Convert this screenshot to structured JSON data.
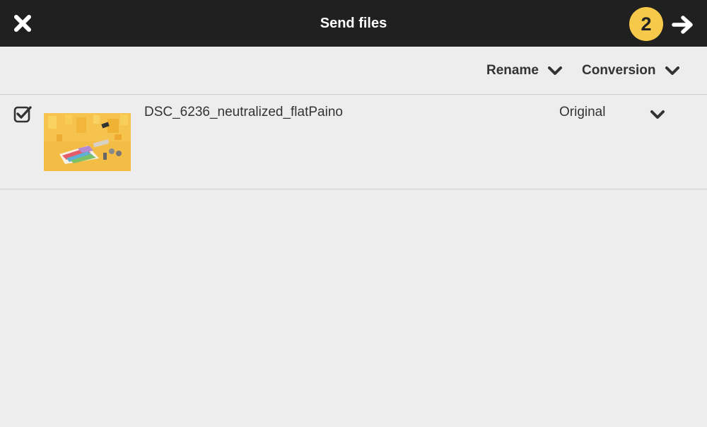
{
  "header": {
    "title": "Send files",
    "step_badge": "2",
    "close_icon": "close-icon",
    "next_icon": "arrow-right-icon",
    "badge_color": "#f6c94b",
    "bar_color": "#202020"
  },
  "toolbar": {
    "rename_label": "Rename",
    "conversion_label": "Conversion"
  },
  "files": [
    {
      "checked": true,
      "name": "DSC_6236_neutralized_flatPaino",
      "conversion": "Original",
      "thumbnail_icon": "image-thumbnail"
    }
  ]
}
